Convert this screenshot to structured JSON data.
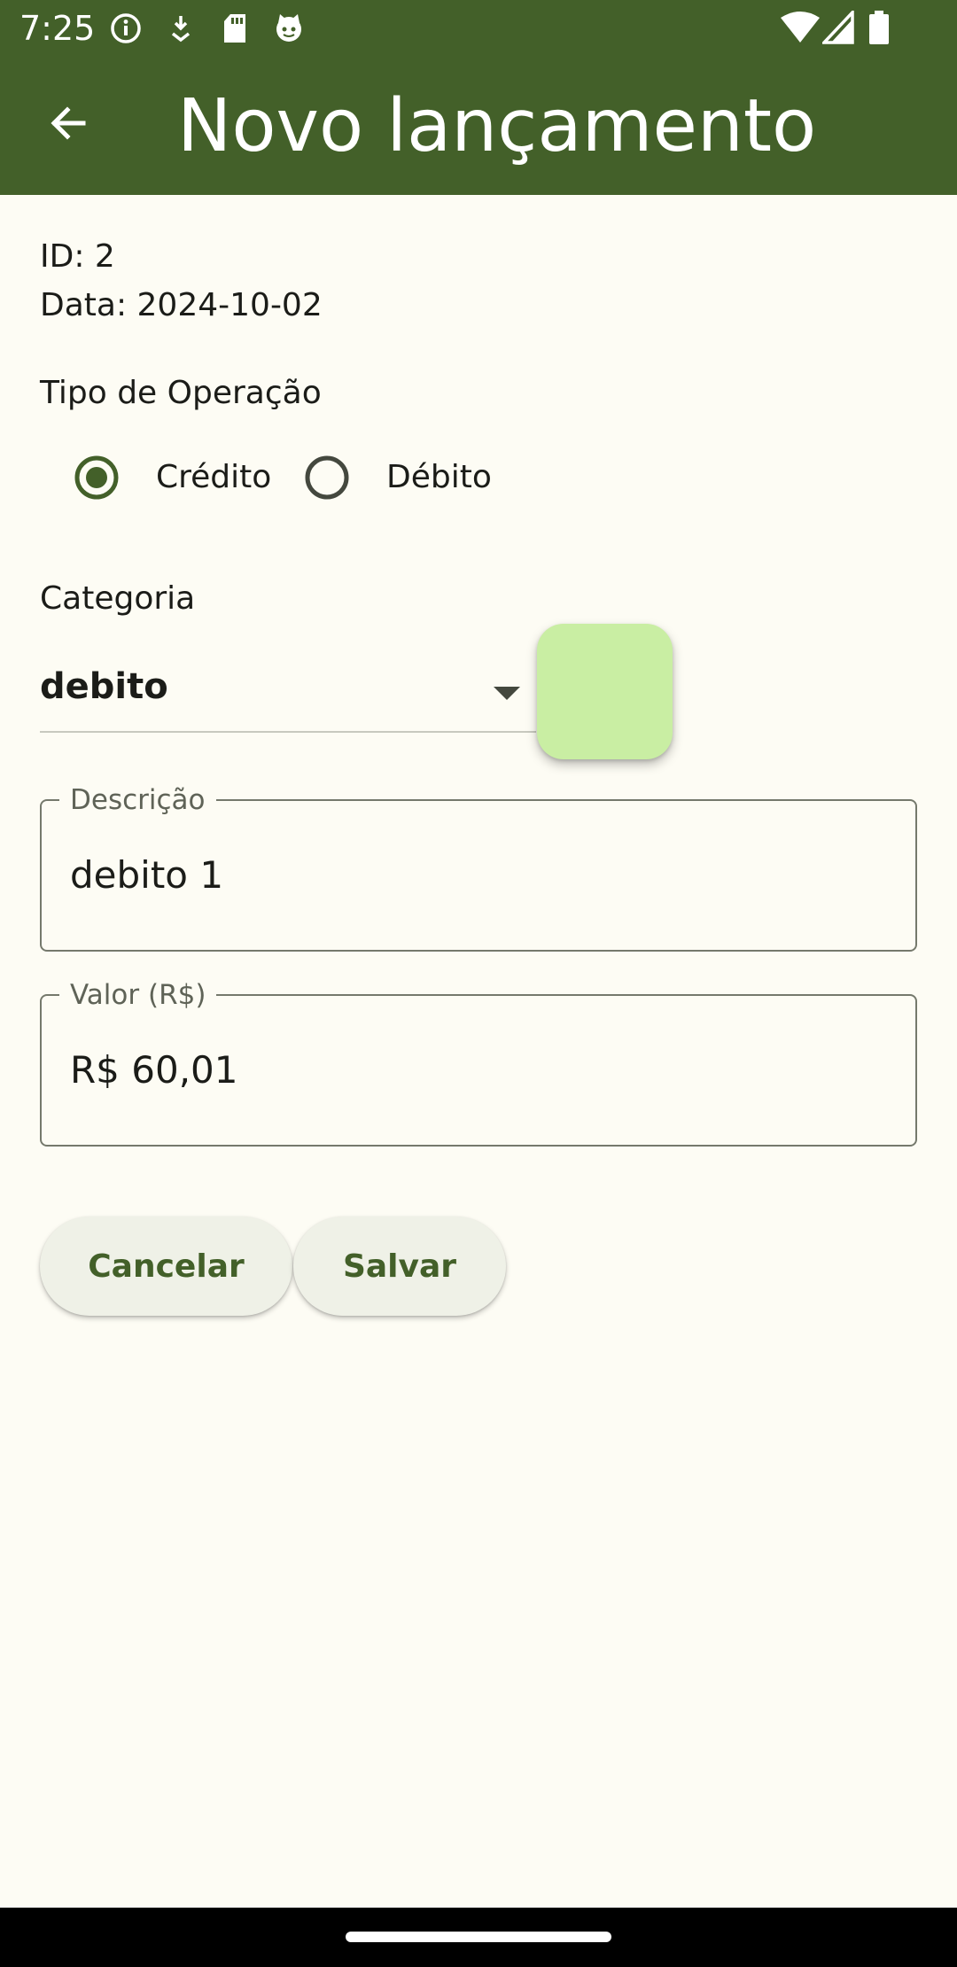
{
  "status_bar": {
    "time": "7:25",
    "icons_left": [
      "info-icon",
      "download-icon",
      "sd-card-icon",
      "cat-icon"
    ],
    "icons_right": [
      "wifi-icon",
      "signal-icon",
      "battery-icon"
    ]
  },
  "app_bar": {
    "title": "Novo lançamento",
    "back_icon": "arrow-back-icon"
  },
  "record": {
    "id_text": "ID: 2",
    "date_text": "Data: 2024-10-02"
  },
  "operation": {
    "label": "Tipo de Operação",
    "options": [
      {
        "label": "Crédito",
        "selected": true
      },
      {
        "label": "Débito",
        "selected": false
      }
    ]
  },
  "category": {
    "label": "Categoria",
    "selected": "debito",
    "color": "#c9eea3"
  },
  "description_field": {
    "label": "Descrição",
    "value": "debito 1"
  },
  "value_field": {
    "label": "Valor (R$)",
    "value": "R$ 60,01"
  },
  "actions": {
    "cancel_label": "Cancelar",
    "save_label": "Salvar"
  },
  "colors": {
    "primary": "#436029",
    "background": "#fdfcf4",
    "button_bg": "#eff1e7"
  }
}
